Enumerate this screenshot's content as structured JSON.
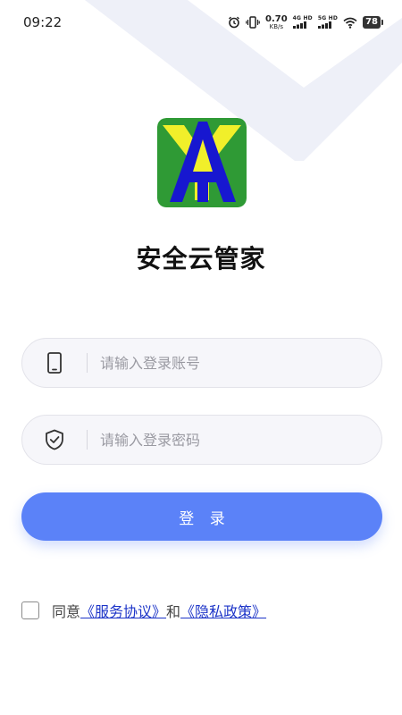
{
  "status_bar": {
    "time": "09:22",
    "net_speed_value": "0.70",
    "net_speed_unit": "KB/s",
    "signal1_label": "4G HD",
    "signal2_label": "5G HD",
    "battery_level": "78",
    "icons": [
      "alarm-icon",
      "vibrate-icon",
      "signal-icon",
      "wifi-icon",
      "battery-icon"
    ]
  },
  "app": {
    "logo_letters": "YA",
    "logo_colors": {
      "background": "#2f9a35",
      "y_letter": "#f1ef2a",
      "a_letter": "#1717d0"
    },
    "title": "安全云管家"
  },
  "form": {
    "account_placeholder": "请输入登录账号",
    "password_placeholder": "请输入登录密码",
    "login_label": "登 录",
    "account_icon": "phone-icon",
    "password_icon": "shield-check-icon"
  },
  "agreement": {
    "prefix": "同意",
    "terms_link": "《服务协议》",
    "conjunction": "和",
    "privacy_link": "《隐私政策》",
    "checked": false
  },
  "colors": {
    "accent": "#5b82f8",
    "link": "#1c34c8",
    "field_bg": "#f6f6fa"
  }
}
